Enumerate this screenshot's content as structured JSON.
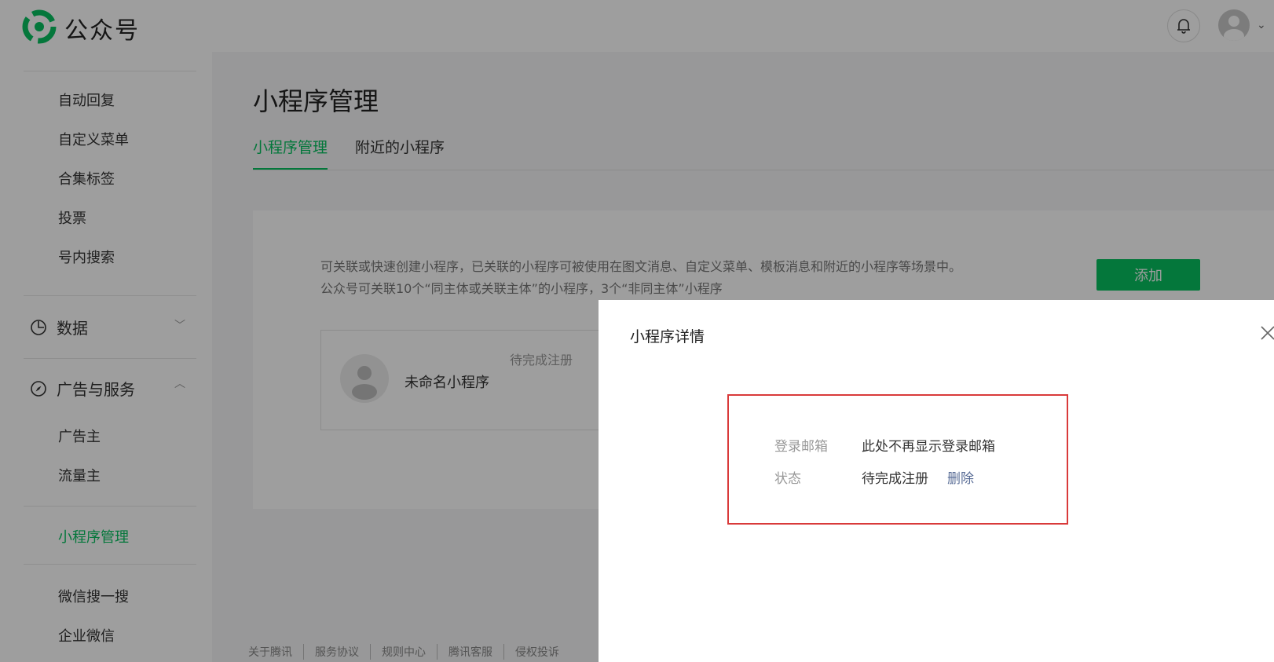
{
  "app": {
    "brand": "公众号"
  },
  "sidebar": {
    "items_top": [
      "自动回复",
      "自定义菜单",
      "合集标签",
      "投票",
      "号内搜索"
    ],
    "group_data": "数据",
    "group_ads": "广告与服务",
    "ads_items": [
      "广告主",
      "流量主"
    ],
    "active_item": "小程序管理",
    "items_bottom": [
      "微信搜一搜",
      "企业微信"
    ]
  },
  "main": {
    "title": "小程序管理",
    "tabs": [
      "小程序管理",
      "附近的小程序"
    ],
    "desc_line1": "可关联或快速创建小程序，已关联的小程序可被使用在图文消息、自定义菜单、模板消息和附近的小程序等场景中。",
    "desc_line2": "公众号可关联10个“同主体或关联主体”的小程序，3个“非同主体”小程序",
    "add_button": "添加",
    "mini_program": {
      "name": "未命名小程序",
      "status": "待完成注册"
    },
    "footer_links": [
      "关于腾讯",
      "服务协议",
      "规则中心",
      "腾讯客服",
      "侵权投诉"
    ]
  },
  "dialog": {
    "title": "小程序详情",
    "email_label": "登录邮箱",
    "email_value": "此处不再显示登录邮箱",
    "status_label": "状态",
    "status_value": "待完成注册",
    "delete_link": "删除"
  },
  "colors": {
    "accent": "#07c160",
    "highlight_border": "#d93a3a",
    "link": "#576b95"
  }
}
